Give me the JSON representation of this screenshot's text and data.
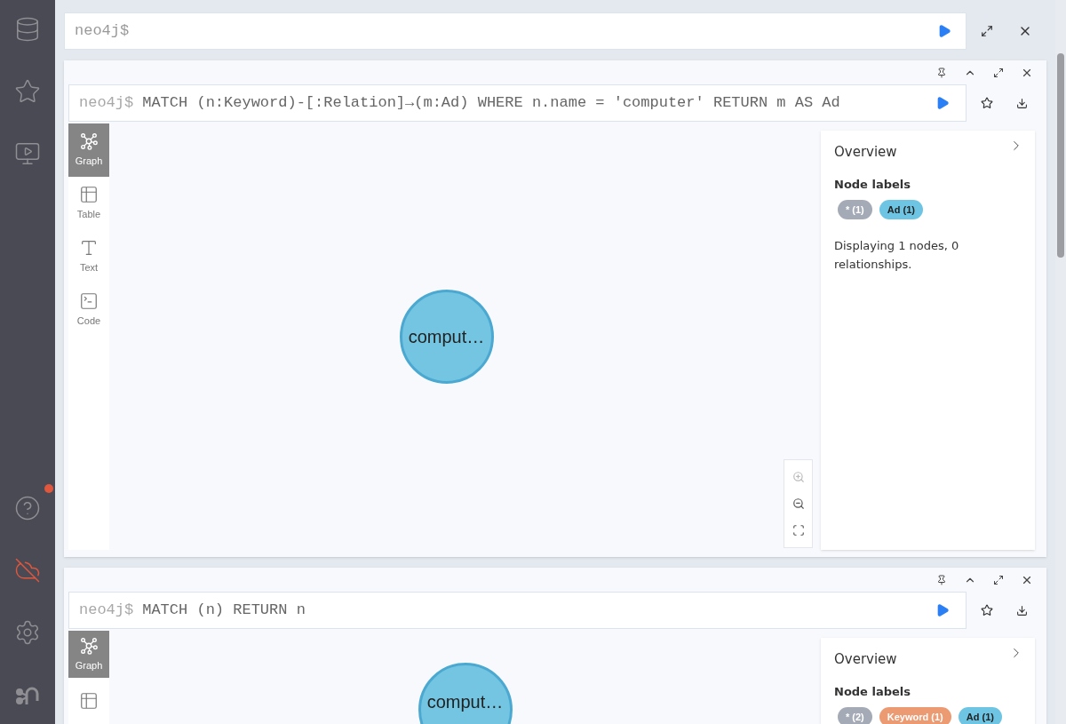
{
  "sidebar": {
    "help_notification": true,
    "connection_error": true
  },
  "top_editor": {
    "prompt": "neo4j$"
  },
  "frames": [
    {
      "prompt": "neo4j$",
      "query": "MATCH (n:Keyword)-[:Relation]→(m:Ad) WHERE n.name = 'computer' RETURN m AS Ad",
      "views": [
        {
          "kind": "graph",
          "label": "Graph",
          "selected": true
        },
        {
          "kind": "table",
          "label": "Table",
          "selected": false
        },
        {
          "kind": "text",
          "label": "Text",
          "selected": false
        },
        {
          "kind": "code",
          "label": "Code",
          "selected": false
        }
      ],
      "node": {
        "caption": "comput…"
      },
      "overview": {
        "title": "Overview",
        "section": "Node labels",
        "labels": [
          {
            "text": "* (1)",
            "color": "#a5abb6",
            "dark_text": false
          },
          {
            "text": "Ad (1)",
            "color": "#6dc5e3",
            "dark_text": true
          }
        ],
        "summary": "Displaying 1 nodes, 0 relationships."
      }
    },
    {
      "prompt": "neo4j$",
      "query": "MATCH (n) RETURN n",
      "views": [
        {
          "kind": "graph",
          "label": "Graph",
          "selected": true
        },
        {
          "kind": "table",
          "selected": false
        }
      ],
      "node": {
        "caption": "comput…"
      },
      "overview": {
        "title": "Overview",
        "section": "Node labels",
        "labels": [
          {
            "text": "* (2)",
            "color": "#a5abb6",
            "dark_text": false
          },
          {
            "text": "Keyword (1)",
            "color": "#ec9a72",
            "dark_text": false
          },
          {
            "text": "Ad (1)",
            "color": "#6dc5e3",
            "dark_text": true
          }
        ]
      }
    }
  ]
}
